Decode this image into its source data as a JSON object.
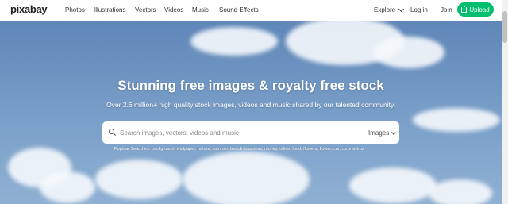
{
  "nav": {
    "logo": "pixabay",
    "links": [
      "Photos",
      "Illustrations",
      "Vectors",
      "Videos",
      "Music",
      "Sound Effects"
    ],
    "explore": "Explore",
    "login": "Log in",
    "join": "Join",
    "upload": "Upload"
  },
  "hero": {
    "headline": "Stunning free images & royalty free stock",
    "subline": "Over 2.6 million+ high quality stock images, videos and music shared by our talented community."
  },
  "search": {
    "placeholder": "Search images, vectors, videos and music",
    "type": "Images"
  },
  "popular": {
    "label": "Popular Searches:",
    "tags": [
      "background",
      "wallpaper",
      "nature",
      "summer",
      "beach",
      "business",
      "money",
      "office",
      "food",
      "flowers",
      "flower",
      "car",
      "coronavirus"
    ]
  },
  "colors": {
    "upload": "#02be6e",
    "sky": "#6f93be"
  },
  "icons": [
    "search-icon",
    "upload-icon",
    "chevron-down-icon"
  ]
}
